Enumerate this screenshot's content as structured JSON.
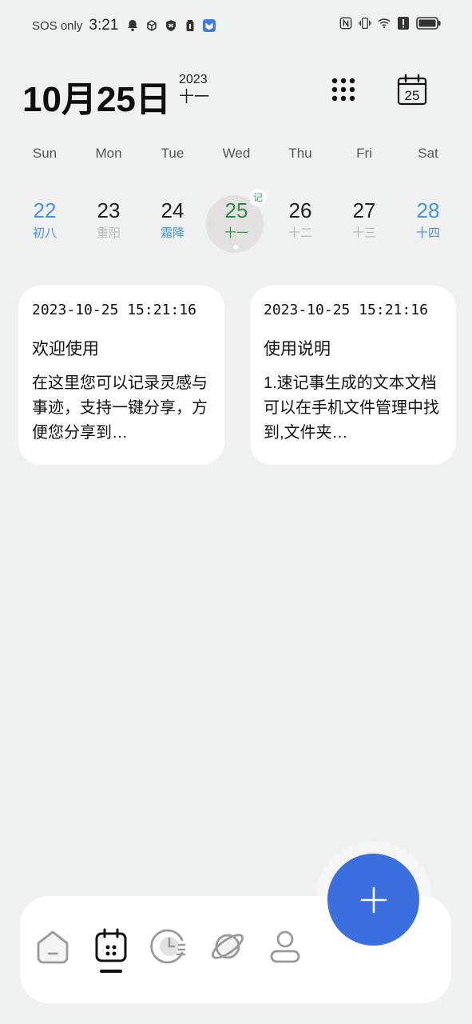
{
  "status_bar": {
    "sos": "SOS only",
    "time": "3:21",
    "left_icons": [
      "bell-icon",
      "cube-icon",
      "shield-icon",
      "battery-saver-icon",
      "app-notification-icon"
    ],
    "right_icons": [
      "nfc-icon",
      "vibrate-icon",
      "wifi-icon",
      "alert-icon",
      "battery-icon"
    ]
  },
  "header": {
    "date": "10月25日",
    "year": "2023",
    "lunar": "十一",
    "grid_icon": "grid-dots-icon",
    "calendar_icon": "calendar-icon",
    "calendar_day": "25"
  },
  "week": {
    "days": [
      "Sun",
      "Mon",
      "Tue",
      "Wed",
      "Thu",
      "Fri",
      "Sat"
    ],
    "dates": [
      {
        "num": "22",
        "lunar": "初八"
      },
      {
        "num": "23",
        "lunar": "重阳"
      },
      {
        "num": "24",
        "lunar": "霜降"
      },
      {
        "num": "25",
        "lunar": "十一"
      },
      {
        "num": "26",
        "lunar": "十二"
      },
      {
        "num": "27",
        "lunar": "十三"
      },
      {
        "num": "28",
        "lunar": "十四"
      }
    ],
    "today_badge": "记"
  },
  "notes": [
    {
      "timestamp": "2023-10-25 15:21:16",
      "title": "欢迎使用",
      "body": "在这里您可以记录灵感与事迹，支持一键分享，方便您分享到…"
    },
    {
      "timestamp": "2023-10-25 15:21:16",
      "title": "使用说明",
      "body": "1.速记事生成的文本文档可以在手机文件管理中找到,文件夹…"
    }
  ],
  "nav": {
    "items": [
      "home-icon",
      "calendar-note-icon",
      "clock-list-icon",
      "planet-icon",
      "profile-icon"
    ],
    "active_index": 1,
    "fab_icon": "plus-icon"
  },
  "colors": {
    "accent": "#3b6ede",
    "weekend": "#4a90e2",
    "today": "#2f8a4a"
  }
}
